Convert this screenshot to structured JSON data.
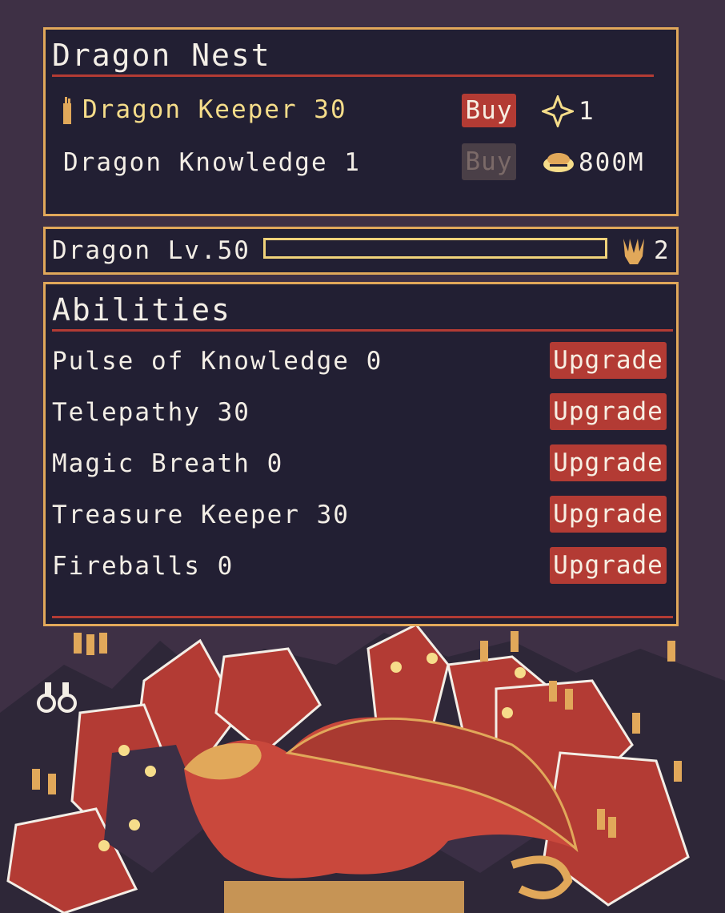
{
  "nest": {
    "title": "Dragon Nest",
    "keeper_label": "Dragon Keeper 30",
    "keeper_buy": "Buy",
    "keeper_cost": "1",
    "knowledge_label": "Dragon Knowledge 1",
    "knowledge_buy": "Buy",
    "knowledge_cost": "800M"
  },
  "dragon": {
    "level_label": "Dragon Lv.50",
    "progress": 0,
    "claws": "2"
  },
  "abilities": {
    "title": "Abilities",
    "items": [
      {
        "label": "Pulse of Knowledge 0",
        "button": "Upgrade"
      },
      {
        "label": "Telepathy 30",
        "button": "Upgrade"
      },
      {
        "label": "Magic Breath 0",
        "button": "Upgrade"
      },
      {
        "label": "Treasure Keeper 30",
        "button": "Upgrade"
      },
      {
        "label": "Fireballs 0",
        "button": "Upgrade"
      }
    ]
  },
  "colors": {
    "accent_red": "#b33b34",
    "panel_bg": "#221f33",
    "border_gold": "#e1a85a",
    "highlight_yellow": "#f6dd8a"
  }
}
